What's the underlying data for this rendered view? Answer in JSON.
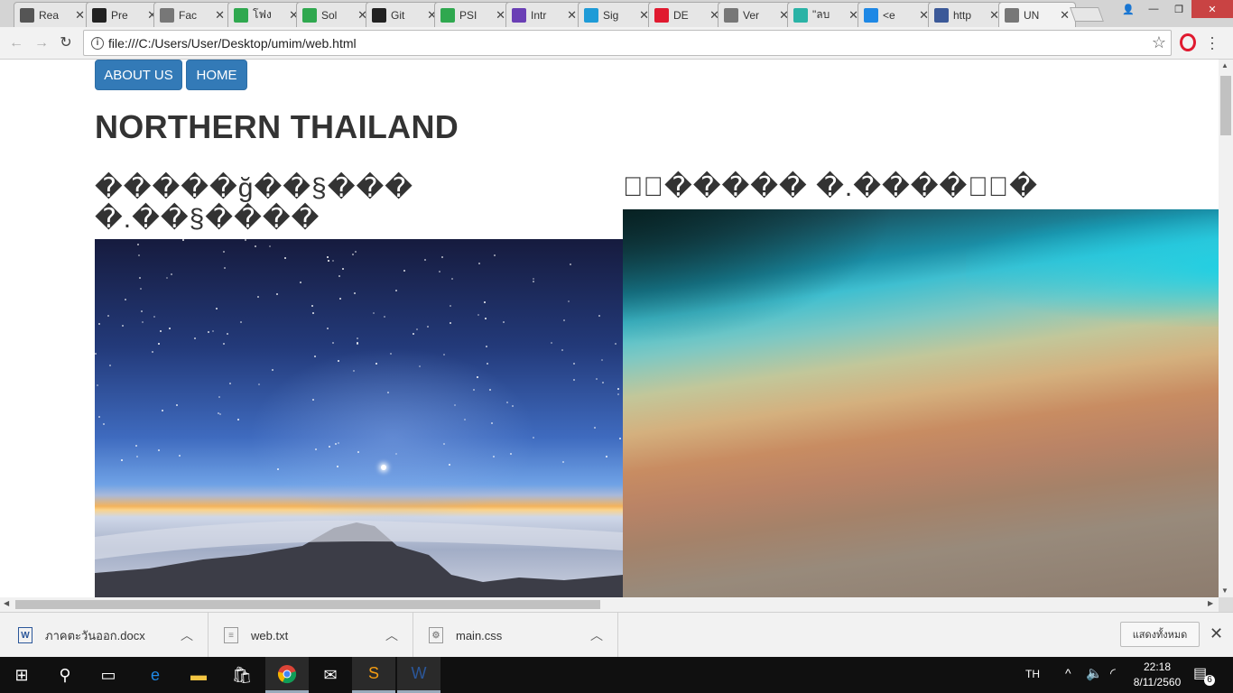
{
  "browser": {
    "tabs": [
      {
        "title": "Rea",
        "icon": "reading-list-icon",
        "color": "#555555"
      },
      {
        "title": "Pre",
        "icon": "github-icon",
        "color": "#222222"
      },
      {
        "title": "Fac",
        "icon": "page-icon",
        "color": "#777777"
      },
      {
        "title": "โฟง",
        "icon": "google-drive-icon",
        "color": "#2fa84f"
      },
      {
        "title": "Sol",
        "icon": "google-drive-icon",
        "color": "#2fa84f"
      },
      {
        "title": "Git",
        "icon": "github-icon",
        "color": "#222222"
      },
      {
        "title": "PSI",
        "icon": "google-drive-icon",
        "color": "#2fa84f"
      },
      {
        "title": "Intr",
        "icon": "forms-icon",
        "color": "#6a3fb5"
      },
      {
        "title": "Sig",
        "icon": "u-logo-icon",
        "color": "#1e9bd7"
      },
      {
        "title": "DE",
        "icon": "music-icon",
        "color": "#e0192f"
      },
      {
        "title": "Ver",
        "icon": "page-icon",
        "color": "#777777"
      },
      {
        "title": "\"ลบ",
        "icon": "t-logo-icon",
        "color": "#2ab3a6"
      },
      {
        "title": "<e",
        "icon": "grid-icon",
        "color": "#1e88e5"
      },
      {
        "title": "http",
        "icon": "facebook-icon",
        "color": "#3b5998"
      },
      {
        "title": "UN",
        "icon": "page-icon",
        "color": "#777777"
      }
    ],
    "close_glyph": "✕",
    "url": "file:///C:/Users/User/Desktop/umim/web.html"
  },
  "page": {
    "nav": {
      "about": "ABOUT US",
      "home": "HOME"
    },
    "title": "NORTHERN THAILAND",
    "left_heading_line1": "�����ğ��§���",
    "left_heading_line2": "�.��§����",
    "right_heading": "�ั����� �.�����ู�"
  },
  "downloads": {
    "items": [
      {
        "name": "ภาคตะวันออก.docx",
        "icon": "word-doc-icon"
      },
      {
        "name": "web.txt",
        "icon": "text-file-icon"
      },
      {
        "name": "main.css",
        "icon": "css-file-icon"
      }
    ],
    "show_all": "แสดงทั้งหมด"
  },
  "taskbar": {
    "lang": "TH",
    "time": "22:18",
    "date": "8/11/2560",
    "notification_count": "6"
  },
  "colors": {
    "nav_button": "#337ab7",
    "title_text": "#333333"
  }
}
